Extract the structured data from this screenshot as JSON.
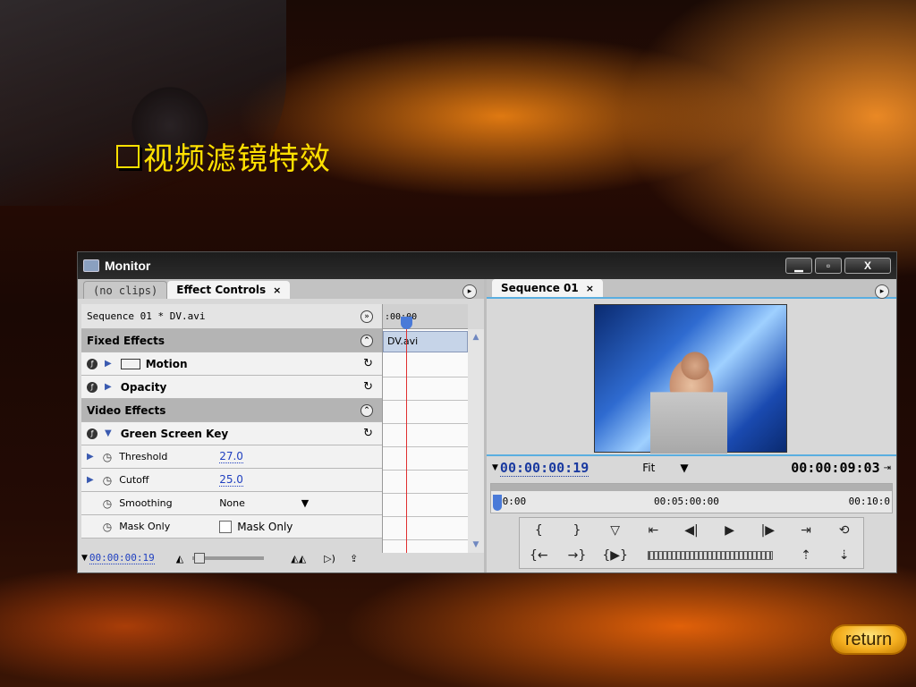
{
  "slide": {
    "title": "视频滤镜特效",
    "return_label": "return"
  },
  "window": {
    "title": "Monitor",
    "buttons": {
      "minimize": "▁",
      "maximize": "▫",
      "close": "X"
    }
  },
  "left_panel": {
    "tabs": [
      {
        "label": "(no clips)"
      },
      {
        "label": "Effect Controls",
        "close": "×"
      }
    ],
    "sequence_label": "Sequence 01 * DV.avi",
    "timeline_start": ":00:00",
    "clip_name": "DV.avi",
    "sections": {
      "fixed": "Fixed Effects",
      "video": "Video Effects"
    },
    "effects": {
      "motion": "Motion",
      "opacity": "Opacity",
      "green_screen": "Green Screen Key"
    },
    "properties": {
      "threshold": {
        "name": "Threshold",
        "value": "27.0"
      },
      "cutoff": {
        "name": "Cutoff",
        "value": "25.0"
      },
      "smoothing": {
        "name": "Smoothing",
        "value": "None"
      },
      "mask_only": {
        "name": "Mask Only",
        "checkbox_label": "Mask Only"
      }
    },
    "current_time": "00:00:00:19"
  },
  "right_panel": {
    "tab": {
      "label": "Sequence 01",
      "close": "×"
    },
    "current_time": "00:00:00:19",
    "zoom": "Fit",
    "duration": "00:00:09:03",
    "ruler": [
      "00:00",
      "00:05:00:00",
      "00:10:0"
    ]
  }
}
